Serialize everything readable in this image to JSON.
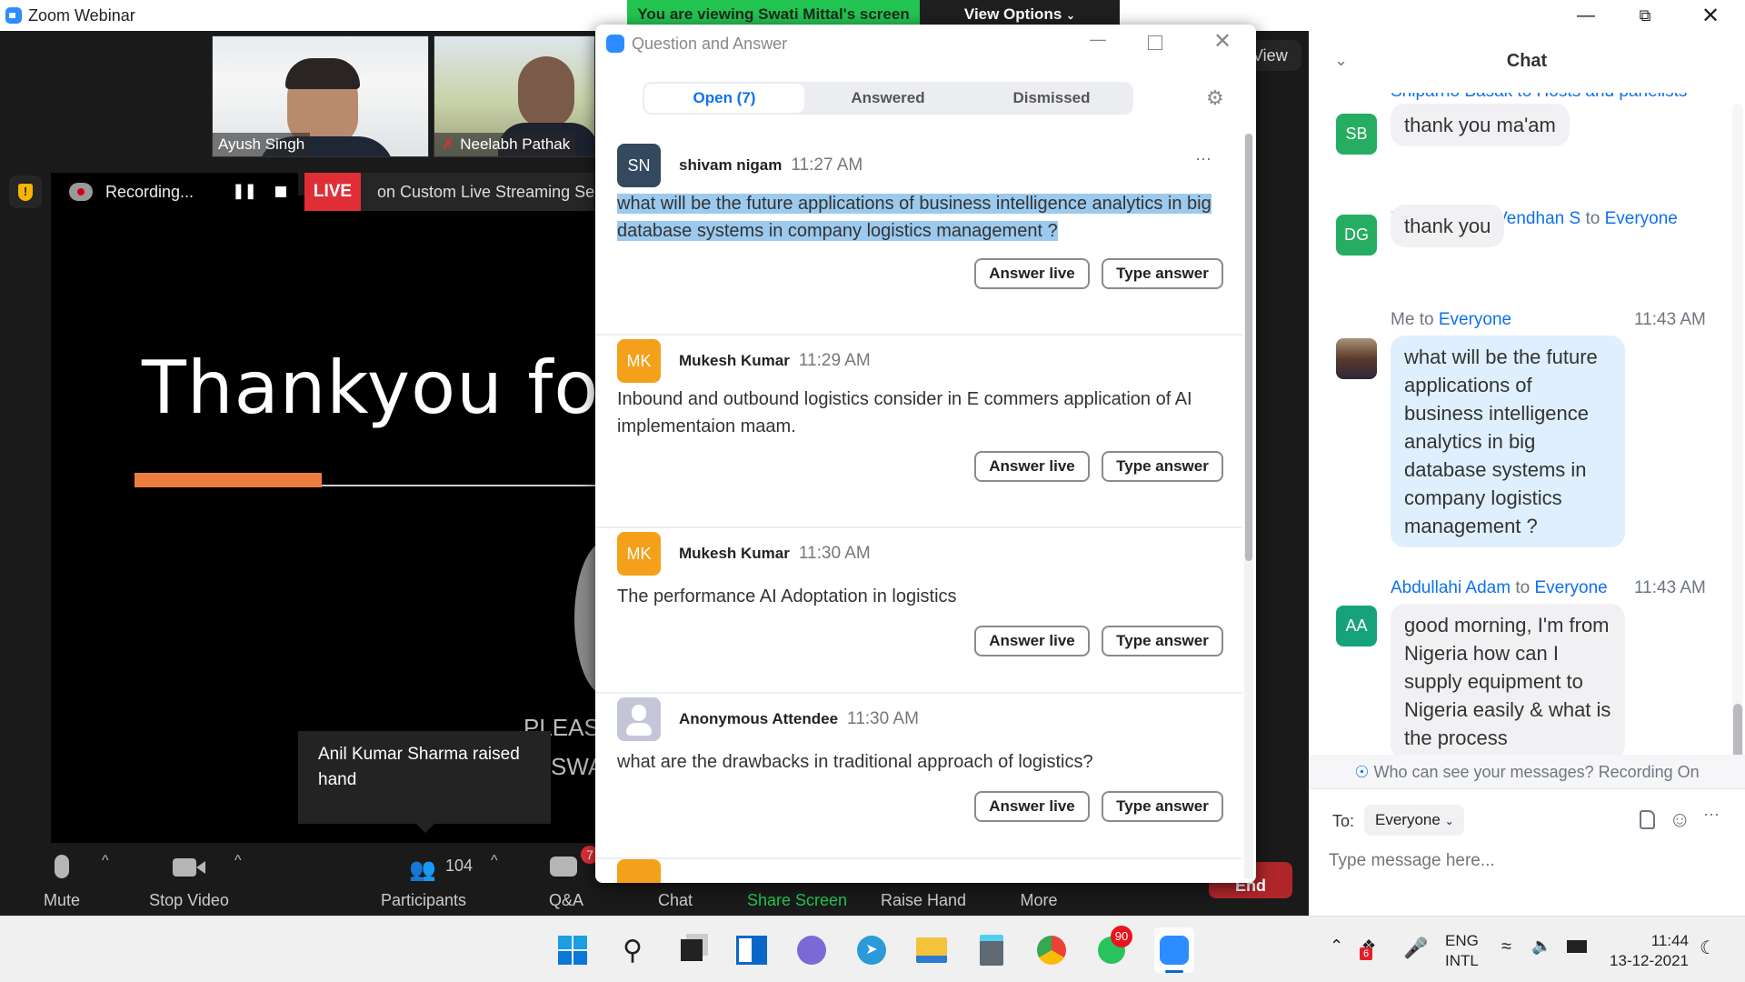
{
  "window": {
    "title": "Zoom Webinar",
    "minimize_icon": "minimize-icon",
    "restore_icon": "restore-icon",
    "close_icon": "close-icon"
  },
  "share_banner": {
    "text": "You are viewing Swati Mittal's screen",
    "view_options": "View Options",
    "view_label": "View"
  },
  "thumbnails": [
    {
      "name": "Ayush Singh",
      "muted": false
    },
    {
      "name": "Neelabh Pathak",
      "muted": true
    }
  ],
  "recording_bar": {
    "status": "Recording...",
    "live_badge": "LIVE",
    "stream_text": "on Custom Live Streaming Ser"
  },
  "slide": {
    "title": "Thankyou for y",
    "footer1": "PLEASE",
    "footer2": "SWA"
  },
  "tooltip": {
    "text": "Anil Kumar Sharma raised hand"
  },
  "qa": {
    "title": "Question and Answer",
    "tabs": [
      {
        "label": "Open (7)",
        "active": true
      },
      {
        "label": "Answered",
        "active": false
      },
      {
        "label": "Dismissed",
        "active": false
      }
    ],
    "answer_live": "Answer live",
    "type_answer": "Type answer",
    "more_icon": "ellipsis-icon",
    "questions": [
      {
        "initials": "SN",
        "name": "shivam nigam",
        "time": "11:27 AM",
        "text": "what will be the future applications of business intelligence analytics in big database systems in company logistics management ?",
        "avatar_color": "#34495e",
        "selected": true
      },
      {
        "initials": "MK",
        "name": "Mukesh Kumar",
        "time": "11:29 AM",
        "text": "Inbound and outbound logistics consider in E commers application of AI implementaion maam.",
        "avatar_color": "#f5a01a",
        "selected": false
      },
      {
        "initials": "MK",
        "name": "Mukesh Kumar",
        "time": "11:30 AM",
        "text": "The performance AI Adoptation in logistics",
        "avatar_color": "#f5a01a",
        "selected": false
      },
      {
        "initials": "",
        "name": "Anonymous Attendee",
        "time": "11:30 AM",
        "text": "what are the drawbacks in traditional approach of logistics?",
        "avatar_color": "#c4c6d8",
        "selected": false
      }
    ]
  },
  "toolbar": {
    "mute": "Mute",
    "stop_video": "Stop Video",
    "participants": "Participants",
    "participants_count": "104",
    "qa": "Q&A",
    "qa_badge": "7",
    "chat": "Chat",
    "share_screen": "Share Screen",
    "raise_hand": "Raise Hand",
    "more": "More",
    "end": "End"
  },
  "chat": {
    "title": "Chat",
    "cutoff_header": "Shiparno Basak to Hosts and panelists",
    "messages": [
      {
        "initials": "SB",
        "sender": "",
        "to": "",
        "time": "",
        "text": "thank you ma'am"
      },
      {
        "initials": "DG",
        "sender": "Dr. Gandhiya Vendhan S",
        "to": "Everyone",
        "time": "",
        "text": "thank you"
      },
      {
        "initials": "",
        "sender": "Me",
        "to": "Everyone",
        "time": "11:43 AM",
        "text": "what will be the future applications of business intelligence analytics in big database systems in company logistics management ?"
      },
      {
        "initials": "AA",
        "sender": "Abdullahi Adam",
        "to": "Everyone",
        "time": "11:43 AM",
        "text": "good morning,  I'm from Nigeria  how can I supply equipment to Nigeria easily & what is the process"
      }
    ],
    "to_word": "to",
    "privacy_note": "Who can see your messages? Recording On",
    "to_label": "To:",
    "recipient": "Everyone",
    "placeholder": "Type message here..."
  },
  "taskbar": {
    "apps": [
      "start",
      "search",
      "task-view",
      "widgets",
      "teams-chat",
      "telegram",
      "file-explorer",
      "calculator",
      "chrome",
      "whatsapp",
      "zoom"
    ],
    "whatsapp_badge": "90",
    "tray_badge": "6",
    "lang1": "ENG",
    "lang2": "INTL",
    "time": "11:44",
    "date": "13-12-2021"
  }
}
